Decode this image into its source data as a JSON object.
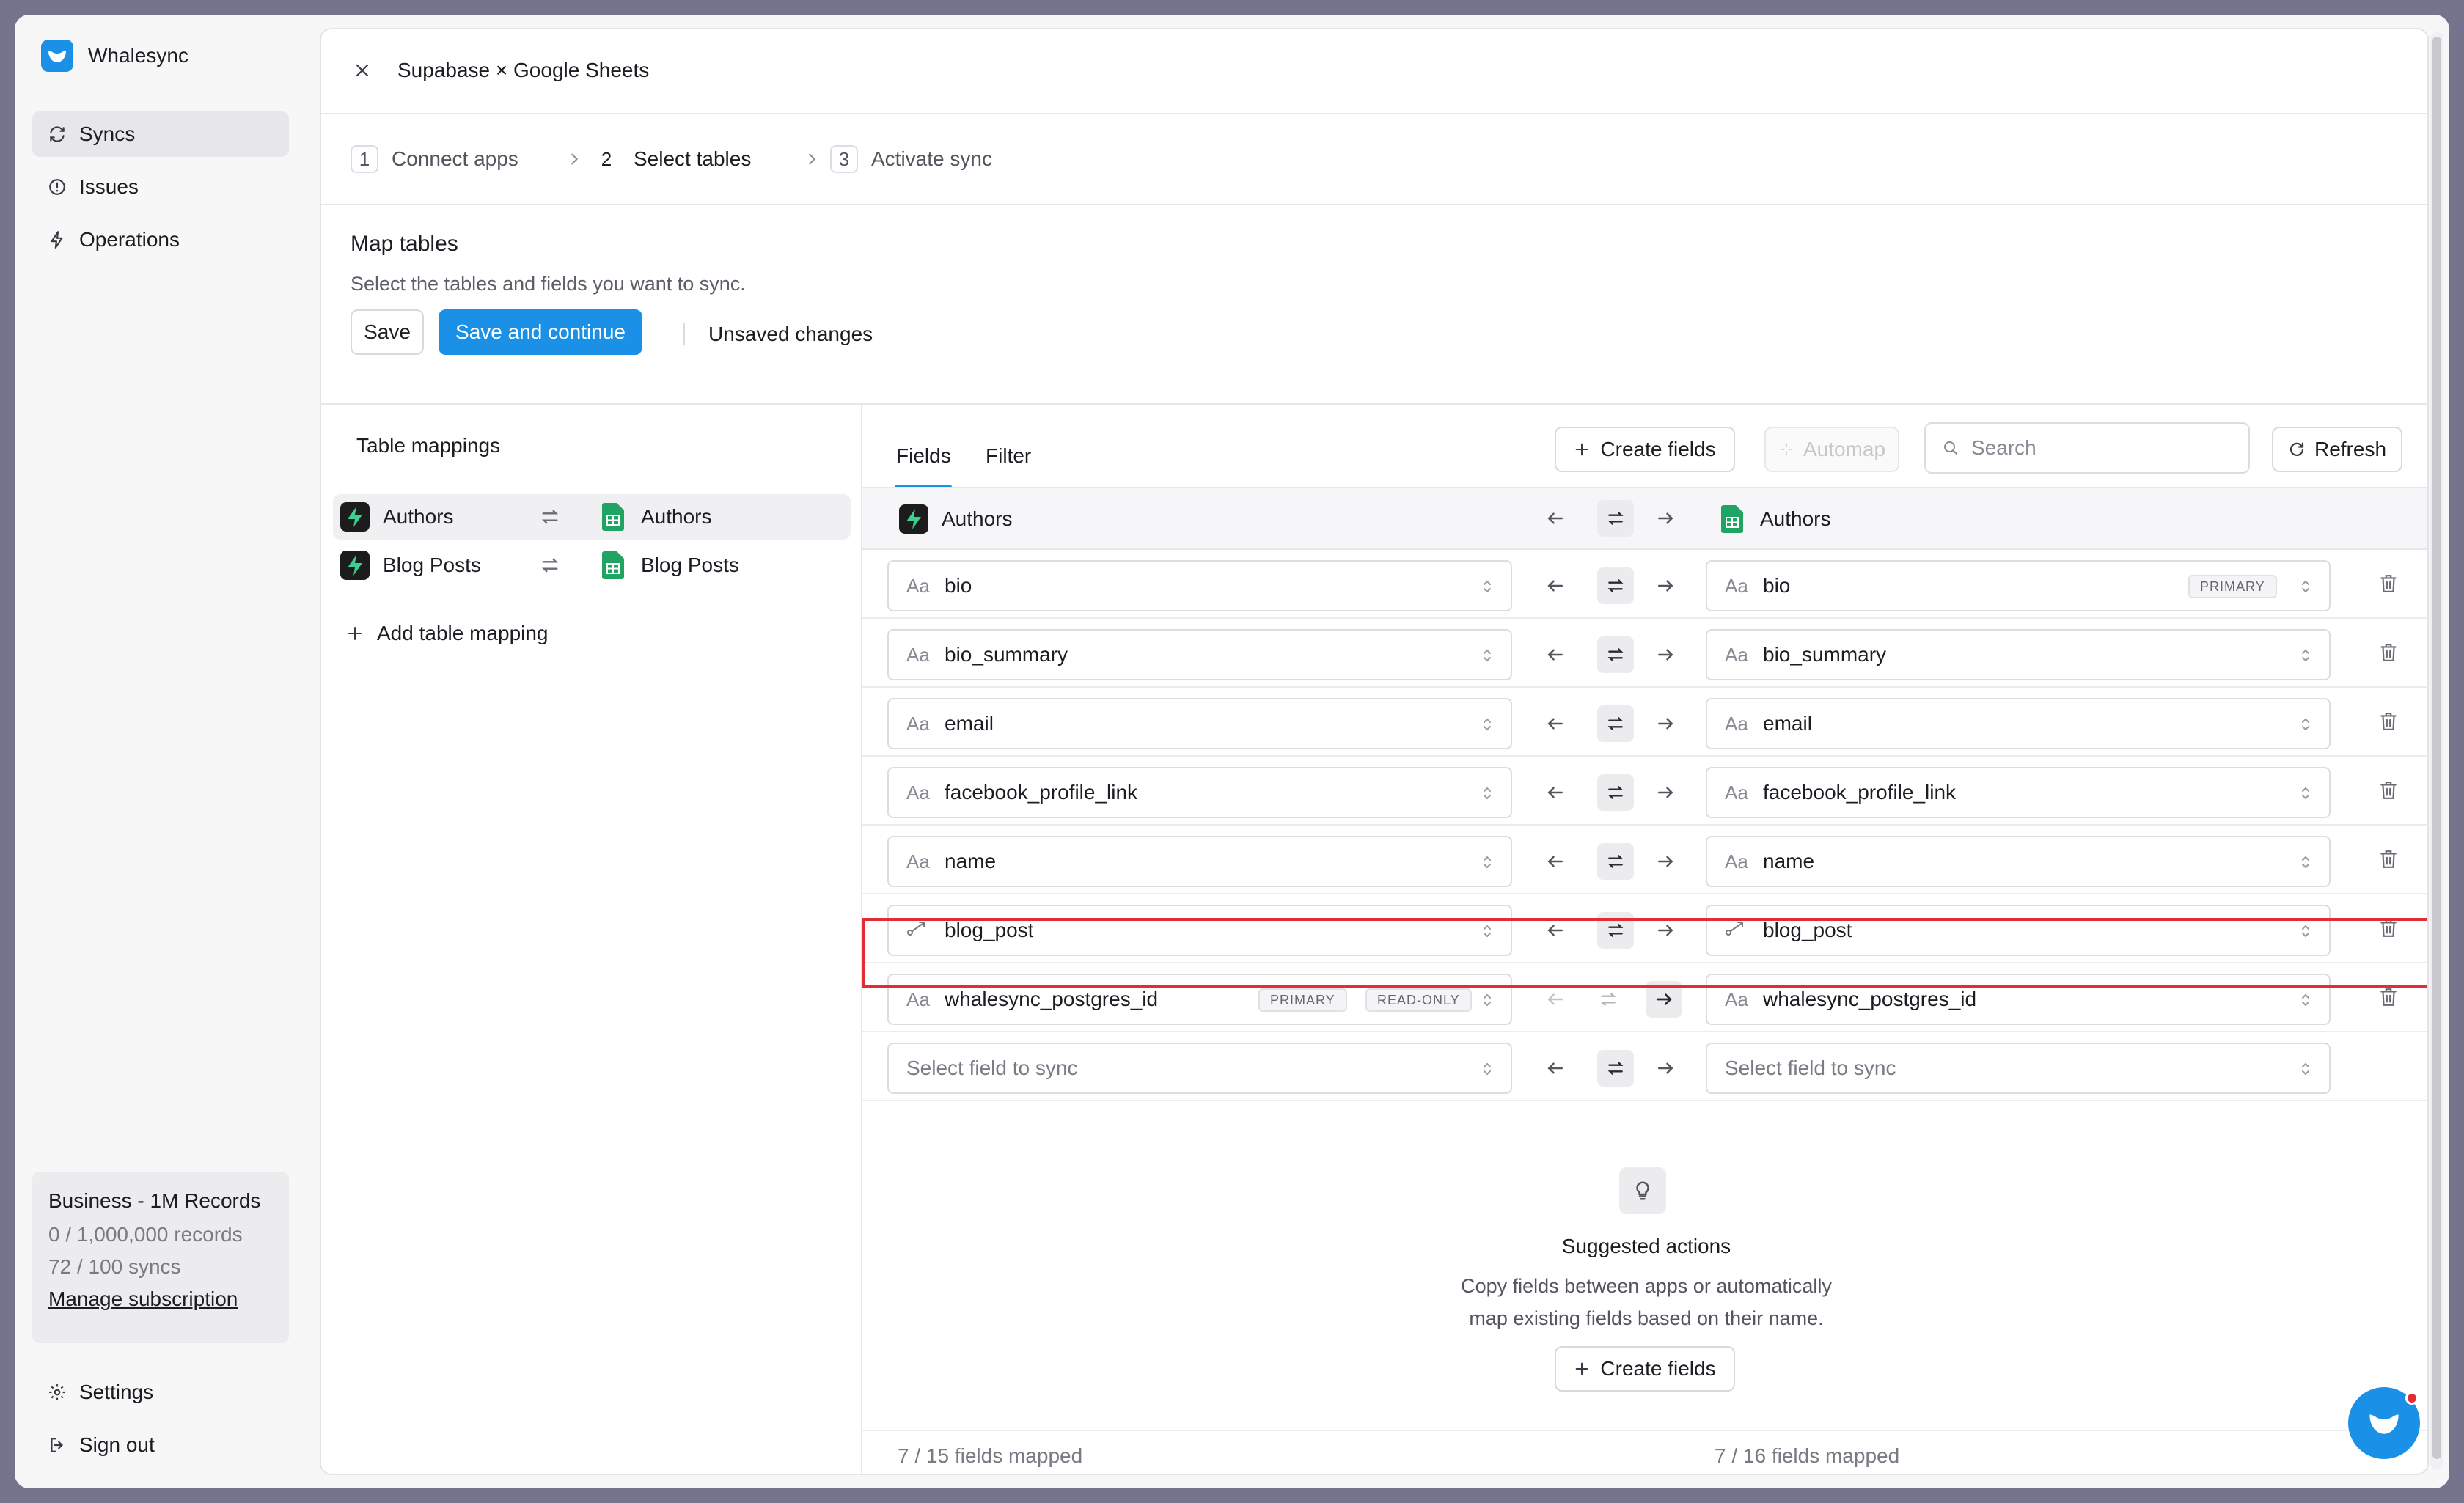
{
  "app": {
    "name": "Whalesync",
    "accent": "#1a90e6",
    "highlight_color": "#e22d37"
  },
  "sidebar": {
    "items": [
      {
        "label": "Syncs",
        "icon": "sync-icon",
        "active": true
      },
      {
        "label": "Issues",
        "icon": "alert-circle-icon"
      },
      {
        "label": "Operations",
        "icon": "bolt-icon"
      }
    ],
    "plan": {
      "title": "Business - 1M Records",
      "records": "0 / 1,000,000 records",
      "syncs": "72 / 100 syncs",
      "manage": "Manage subscription"
    },
    "bottom": [
      {
        "label": "Settings",
        "icon": "gear-icon"
      },
      {
        "label": "Sign out",
        "icon": "sign-out-icon"
      }
    ]
  },
  "header": {
    "title": "Supabase × Google Sheets"
  },
  "steps": [
    {
      "num": "1",
      "label": "Connect apps"
    },
    {
      "num": "2",
      "label": "Select tables",
      "active": true
    },
    {
      "num": "3",
      "label": "Activate sync"
    }
  ],
  "map": {
    "title": "Map tables",
    "subtitle": "Select the tables and fields you want to sync.",
    "save": "Save",
    "save_continue": "Save and continue",
    "status": "Unsaved changes"
  },
  "table_mappings": {
    "title": "Table mappings",
    "rows": [
      {
        "source": "Authors",
        "dest": "Authors",
        "active": true
      },
      {
        "source": "Blog Posts",
        "dest": "Blog Posts"
      }
    ],
    "add": "Add table mapping"
  },
  "fields": {
    "tabs": [
      "Fields",
      "Filter"
    ],
    "create": "Create fields",
    "automap": "Automap",
    "search_placeholder": "Search",
    "refresh": "Refresh",
    "source_table": "Authors",
    "dest_table": "Authors",
    "type_text": "Aa",
    "primary": "PRIMARY",
    "readonly": "READ-ONLY",
    "placeholder": "Select field to sync",
    "rows": [
      {
        "left": "bio",
        "right": "bio"
      },
      {
        "left": "bio_summary",
        "right": "bio_summary"
      },
      {
        "left": "email",
        "right": "email"
      },
      {
        "left": "facebook_profile_link",
        "right": "facebook_profile_link"
      },
      {
        "left": "name",
        "right": "name"
      },
      {
        "left": "blog_post",
        "right": "blog_post"
      },
      {
        "left": "whalesync_postgres_id",
        "right": "whalesync_postgres_id"
      }
    ],
    "suggest_title": "Suggested actions",
    "suggest_line1": "Copy fields between apps or automatically",
    "suggest_line2": "map existing fields based on their name.",
    "left_count": "7 / 15 fields mapped",
    "right_count": "7 / 16 fields mapped"
  }
}
